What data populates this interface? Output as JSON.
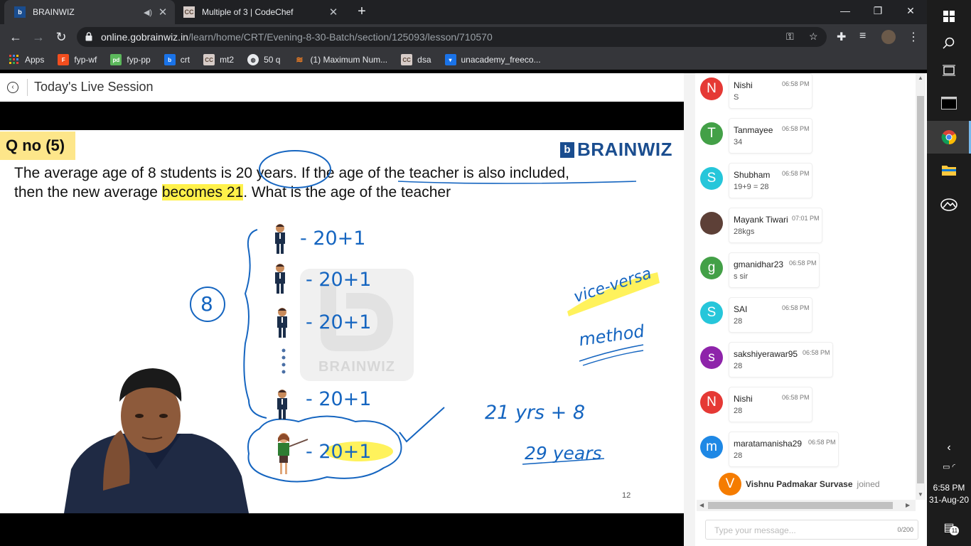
{
  "browser": {
    "tabs": [
      {
        "title": "BRAINWIZ",
        "active": true,
        "audio": true
      },
      {
        "title": "Multiple of 3 | CodeChef",
        "active": false,
        "audio": false
      }
    ],
    "url_host": "online.gobrainwiz.in",
    "url_path": "/learn/home/CRT/Evening-8-30-Batch/section/125093/lesson/710570",
    "bookmarks": [
      {
        "label": "Apps",
        "icon": "apps-grid-icon",
        "color": "#ea4335"
      },
      {
        "label": "fyp-wf",
        "icon": "figma-icon",
        "color": "#f24e1e"
      },
      {
        "label": "fyp-pp",
        "icon": "pd-icon",
        "color": "#5cb85c"
      },
      {
        "label": "crt",
        "icon": "brainwiz-icon",
        "color": "#1a73e8"
      },
      {
        "label": "mt2",
        "icon": "codechef-icon",
        "color": "#5b4638"
      },
      {
        "label": "50 q",
        "icon": "globe-icon",
        "color": "#e8eaed"
      },
      {
        "label": "(1) Maximum Num...",
        "icon": "stackoverflow-icon",
        "color": "#f48024"
      },
      {
        "label": "dsa",
        "icon": "codechef-icon",
        "color": "#5b4638"
      },
      {
        "label": "unacademy_freeco...",
        "icon": "unacademy-icon",
        "color": "#1a73e8"
      }
    ]
  },
  "page": {
    "title": "Today's Live Session"
  },
  "slide": {
    "qno": "Q no (5)",
    "brand": "BRAINWIZ",
    "question_parts": {
      "p1": "The average age of 8 students is ",
      "p2": "20 years",
      "p3": ". If the age of the teacher is also included,",
      "p4": "then the new average ",
      "p5": "becomes 21",
      "p6": ". What is the age of the teacher"
    },
    "handwriting": {
      "circle8": "8",
      "row1": "- 20+1",
      "row2": "- 20+1",
      "row3": "- 20+1",
      "row4": "- 20+1",
      "teacher_row": "- 20+1",
      "vice": "vice-versa",
      "method": "method",
      "eq1": "21 yrs + 8",
      "eq2": "29 years"
    },
    "watermark": "BRAINWIZ",
    "slide_number": "12"
  },
  "chat": {
    "messages": [
      {
        "initial": "N",
        "name": "Nishi",
        "time": "06:58 PM",
        "text": "S",
        "color": "#e53935"
      },
      {
        "initial": "T",
        "name": "Tanmayee",
        "time": "06:58 PM",
        "text": "34",
        "color": "#43a047"
      },
      {
        "initial": "S",
        "name": "Shubham",
        "time": "06:58 PM",
        "text": "19+9 = 28",
        "color": "#26c6da"
      },
      {
        "initial": "",
        "name": "Mayank Tiwari",
        "time": "07:01 PM",
        "text": "28kgs",
        "color": "#5d4037"
      },
      {
        "initial": "g",
        "name": "gmanidhar23",
        "time": "06:58 PM",
        "text": "s sir",
        "color": "#43a047"
      },
      {
        "initial": "S",
        "name": "SAI",
        "time": "06:58 PM",
        "text": "28",
        "color": "#26c6da"
      },
      {
        "initial": "s",
        "name": "sakshiyerawar95",
        "time": "06:58 PM",
        "text": "28",
        "color": "#8e24aa"
      },
      {
        "initial": "N",
        "name": "Nishi",
        "time": "06:58 PM",
        "text": "28",
        "color": "#e53935"
      },
      {
        "initial": "m",
        "name": "maratamanisha29",
        "time": "06:58 PM",
        "text": "28",
        "color": "#1e88e5"
      }
    ],
    "joined": {
      "initial": "V",
      "name": "Vishnu Padmakar Survase",
      "text": "joined"
    },
    "input_placeholder": "Type your message...",
    "char_count": "0/200"
  },
  "taskbar": {
    "time": "6:58 PM",
    "date": "31-Aug-20",
    "notifications": "11"
  }
}
